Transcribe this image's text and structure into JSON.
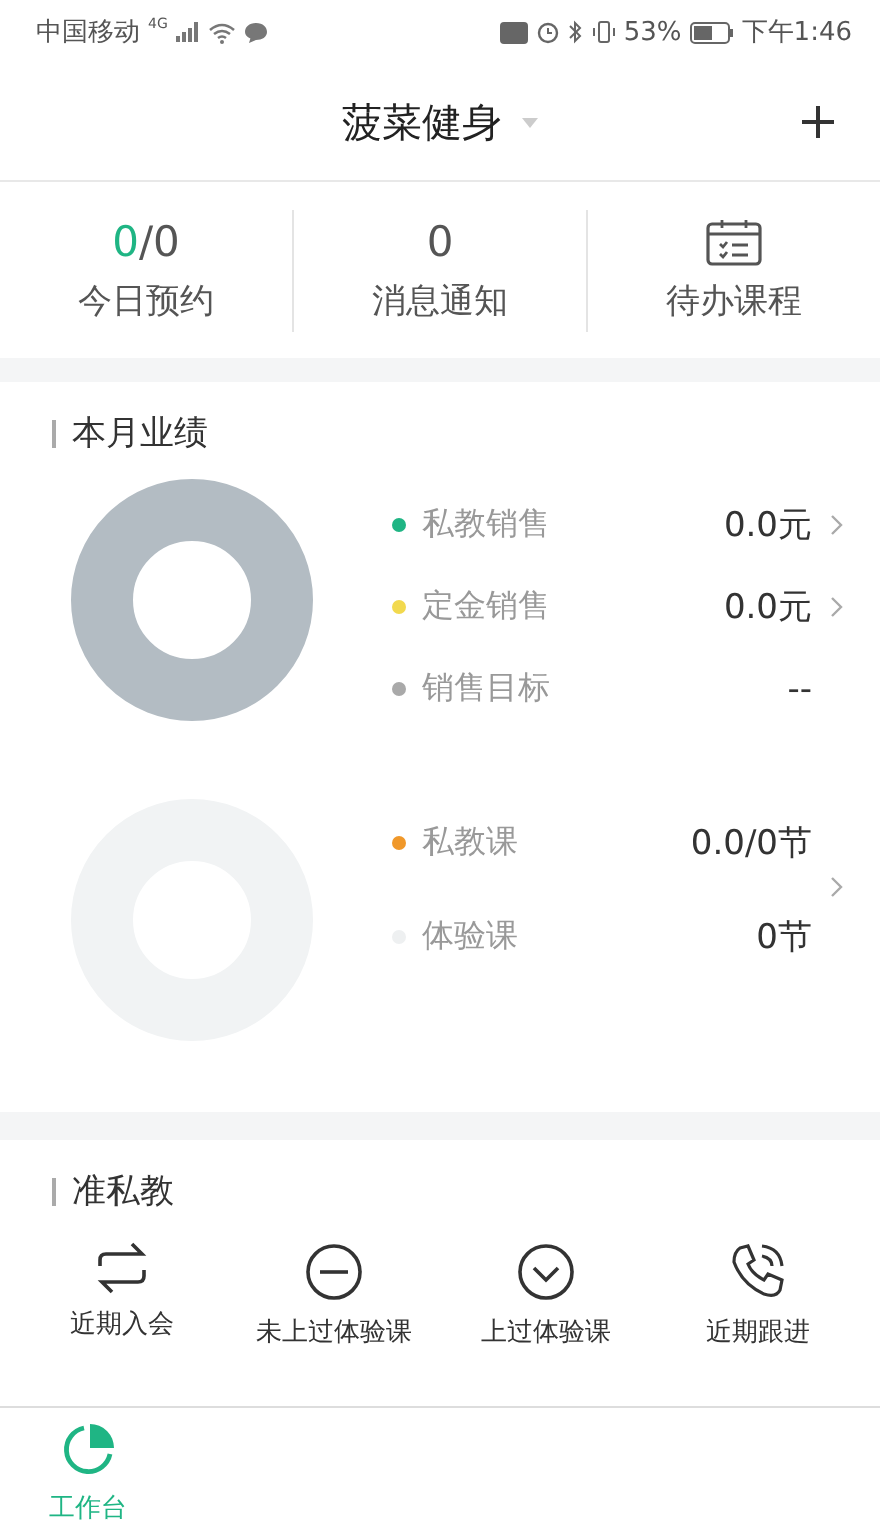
{
  "status_bar": {
    "carrier": "中国移动",
    "network": "4G",
    "battery": "53%",
    "time": "下午1:46"
  },
  "header": {
    "title": "菠菜健身"
  },
  "stats": [
    {
      "kind": "count",
      "done": "0",
      "total": "/0",
      "label": "今日预约"
    },
    {
      "kind": "number",
      "value": "0",
      "label": "消息通知"
    },
    {
      "kind": "icon",
      "label": "待办课程"
    }
  ],
  "performance": {
    "title": "本月业绩",
    "groups": [
      {
        "items": [
          {
            "label": "私教销售",
            "value": "0.0元",
            "color": "#1fb584",
            "arrow": true
          },
          {
            "label": "定金销售",
            "value": "0.0元",
            "color": "#f2d94e",
            "arrow": true
          },
          {
            "label": "销售目标",
            "value": "--",
            "color": "#a9a9a9",
            "arrow": false
          }
        ],
        "group_arrow": false
      },
      {
        "items": [
          {
            "label": "私教课",
            "value": "0.0/0节",
            "color": "#f0982a",
            "arrow": false
          },
          {
            "label": "体验课",
            "value": "0节",
            "color": "#eef0f1",
            "arrow": false
          }
        ],
        "group_arrow": true
      }
    ]
  },
  "prospects": {
    "title": "准私教",
    "actions": [
      {
        "kind": "swap",
        "label": "近期入会"
      },
      {
        "kind": "minus",
        "label": "未上过体验课"
      },
      {
        "kind": "check",
        "label": "上过体验课"
      },
      {
        "kind": "phone",
        "label": "近期跟进"
      }
    ]
  },
  "tab_bar": [
    {
      "label": "工作台",
      "selected": true
    }
  ]
}
